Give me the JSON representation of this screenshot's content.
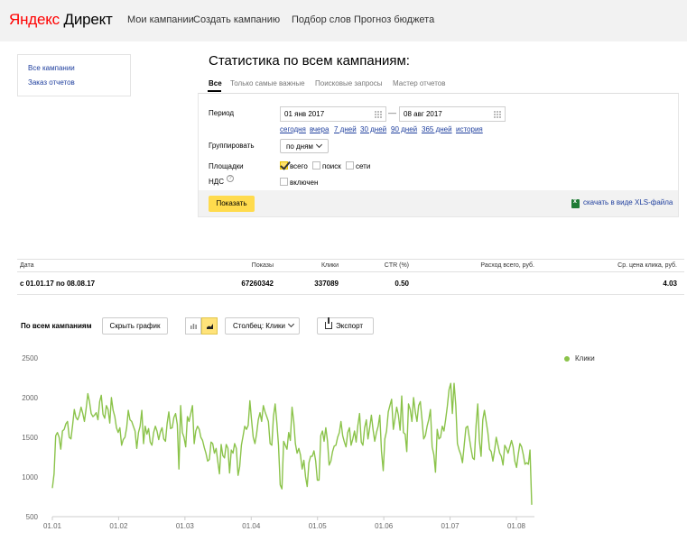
{
  "header": {
    "logo_ya": "Яндекс",
    "logo_rest": "Директ",
    "nav": [
      "Мои кампании",
      "Создать кампанию",
      "Подбор слов",
      "Прогноз бюджета"
    ]
  },
  "sidebar": {
    "items": [
      "Все кампании",
      "Заказ отчетов"
    ]
  },
  "main": {
    "title": "Статистика по всем кампаниям:",
    "tabs": [
      "Все",
      "Только самые важные",
      "Поисковые запросы",
      "Мастер отчетов"
    ]
  },
  "form": {
    "period_label": "Период",
    "date_from": "01 янв 2017",
    "date_to": "08 авг 2017",
    "dash": "—",
    "quick_links": [
      "сегодня",
      "вчера",
      "7 дней",
      "30 дней",
      "90 дней",
      "365 дней",
      "история"
    ],
    "group_label": "Группировать",
    "group_value": "по дням",
    "sites_label": "Площадки",
    "sites_options": [
      {
        "label": "всего",
        "checked": true
      },
      {
        "label": "поиск",
        "checked": false
      },
      {
        "label": "сети",
        "checked": false
      }
    ],
    "vat_label": "НДС",
    "vat_help": "?",
    "vat_option": "включен",
    "show_button": "Показать",
    "xls_link": "скачать в виде XLS-файла"
  },
  "summary": {
    "headers": [
      "Дата",
      "Показы",
      "Клики",
      "CTR (%)",
      "Расход всего, руб.",
      "Ср. цена клика, руб."
    ],
    "row": [
      "с 01.01.17 по 08.08.17",
      "67260342",
      "337089",
      "0.50",
      "",
      "4.03"
    ]
  },
  "chart_controls": {
    "title": "По всем кампаниям",
    "hide_button": "Скрыть график",
    "column_select": "Столбец: Клики",
    "export_button": "Экспорт"
  },
  "colors": {
    "accent": "#ffdb4d",
    "series": "#8bc34a",
    "link": "#1f3f9e"
  },
  "chart_data": {
    "type": "line",
    "title": "",
    "xlabel": "",
    "ylabel": "",
    "ylim": [
      500,
      2500
    ],
    "yticks": [
      500,
      1000,
      1500,
      2000,
      2500
    ],
    "xticks": [
      "01.01",
      "01.02",
      "01.03",
      "01.04",
      "01.05",
      "01.06",
      "01.07",
      "01.08"
    ],
    "grid": false,
    "legend_position": "top-right",
    "series": [
      {
        "name": "Клики",
        "color": "#8bc34a",
        "values": [
          860,
          1040,
          1520,
          1560,
          1500,
          1350,
          1580,
          1600,
          1670,
          1700,
          1500,
          1480,
          1650,
          1850,
          1750,
          1720,
          1780,
          1880,
          1800,
          1700,
          1860,
          2050,
          1950,
          1800,
          1760,
          1780,
          1810,
          1720,
          1950,
          2030,
          1790,
          1740,
          1900,
          1850,
          1680,
          2000,
          1840,
          1760,
          1620,
          1560,
          1620,
          1400,
          1470,
          1500,
          1620,
          1840,
          1720,
          1700,
          1640,
          1580,
          1360,
          1560,
          1640,
          1840,
          1420,
          1640,
          1540,
          1610,
          1440,
          1400,
          1560,
          1640,
          1580,
          1470,
          1570,
          1620,
          1480,
          1450,
          1670,
          1820,
          1610,
          1620,
          1750,
          1800,
          1660,
          1100,
          1900,
          1560,
          1500,
          1380,
          1760,
          1700,
          1800,
          1900,
          1420,
          1580,
          1640,
          1600,
          1500,
          1460,
          1370,
          1300,
          1200,
          1220,
          1440,
          1420,
          1300,
          1360,
          1200,
          1040,
          1410,
          1270,
          1240,
          1410,
          1360,
          1050,
          1340,
          1300,
          1420,
          1360,
          1020,
          1130,
          1400,
          1520,
          1640,
          1600,
          1650,
          1960,
          1720,
          1500,
          1420,
          1540,
          1720,
          1810,
          1700,
          1900,
          1820,
          1760,
          1700,
          1420,
          1400,
          1760,
          1920,
          1680,
          1400,
          900,
          850,
          1450,
          1400,
          1350,
          1560,
          1460,
          1880,
          1700,
          1420,
          1300,
          1360,
          1280,
          1100,
          1210,
          1000,
          880,
          1180,
          1260,
          1260,
          1330,
          1200,
          960,
          960,
          1520,
          1580,
          1450,
          1620,
          1450,
          1150,
          1200,
          1320,
          1390,
          1400,
          1500,
          1560,
          1700,
          1520,
          1440,
          1380,
          1560,
          1620,
          1400,
          1480,
          1580,
          1440,
          1650,
          1800,
          1440,
          1400,
          1620,
          1720,
          1480,
          1620,
          1780,
          1600,
          1450,
          1560,
          1640,
          1780,
          1320,
          1080,
          1480,
          1580,
          1820,
          1900,
          1980,
          1600,
          1740,
          1880,
          1780,
          1590,
          2020,
          1560,
          1540,
          1320,
          1920,
          1850,
          1700,
          2000,
          1820,
          1700,
          1900,
          1950,
          1720,
          1480,
          1520,
          1640,
          1720,
          1850,
          1380,
          1280,
          1060,
          1600,
          1480,
          1500,
          1640,
          1580,
          1720,
          1890,
          2100,
          2180,
          1800,
          2180,
          1900,
          1420,
          1340,
          1280,
          1180,
          1400,
          1620,
          1640,
          1500,
          1360,
          1240,
          1220,
          1640,
          1920,
          1460,
          1260,
          1720,
          1840,
          1700,
          1560,
          1350,
          1320,
          1200,
          1340,
          1500,
          1400,
          1300,
          1260,
          1150,
          1400,
          1360,
          1300,
          1380,
          1460,
          1380,
          1200,
          1120,
          1280,
          1420,
          1380,
          1280,
          1160,
          1180,
          1160,
          1340,
          650
        ]
      }
    ]
  }
}
